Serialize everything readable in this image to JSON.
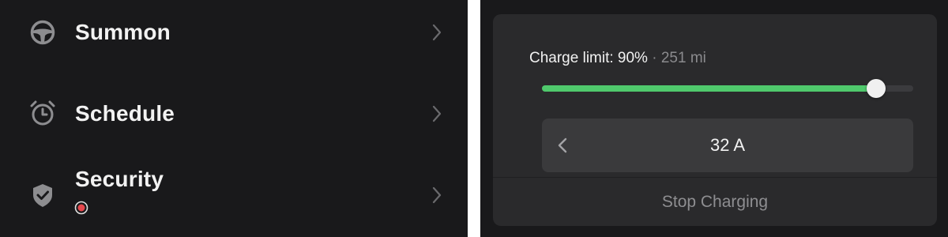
{
  "menu": {
    "items": [
      {
        "label": "Summon",
        "icon": "steering-wheel-icon"
      },
      {
        "label": "Schedule",
        "icon": "alarm-clock-icon"
      },
      {
        "label": "Security",
        "icon": "shield-check-icon",
        "alert": true
      }
    ]
  },
  "charging": {
    "limit_label": "Charge limit: 90%",
    "separator": "·",
    "range": "251 mi",
    "limit_percent": 90,
    "current_value": "32 A",
    "stop_label": "Stop Charging"
  },
  "colors": {
    "background": "#19191b",
    "card": "#2a2a2c",
    "accent_green": "#4fc96c",
    "alert_red": "#e5484d"
  }
}
